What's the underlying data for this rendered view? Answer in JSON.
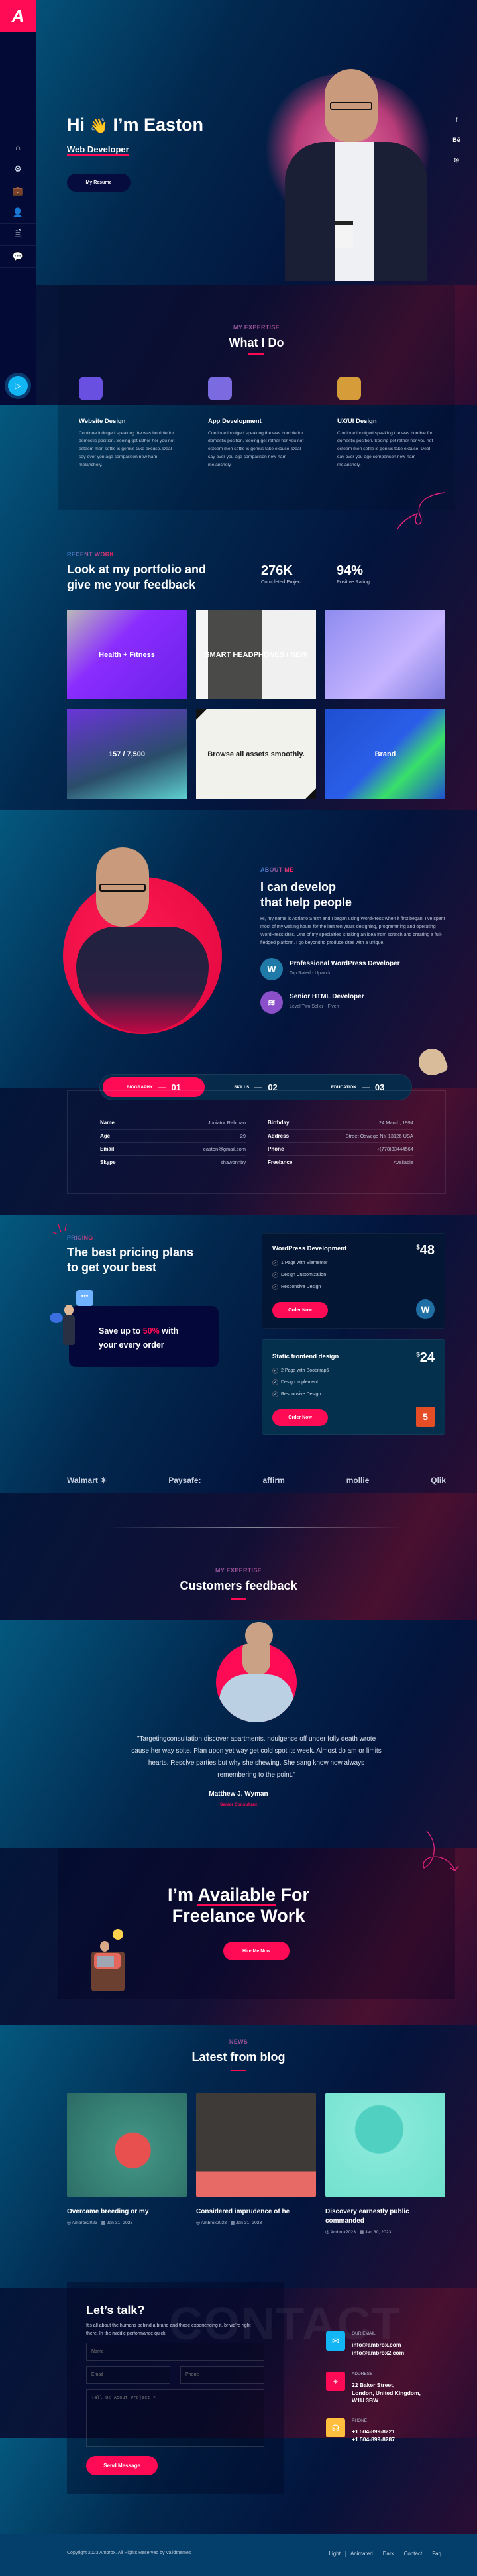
{
  "sidebar": {
    "logo": "A",
    "nav": [
      {
        "icon": "home-icon",
        "glyph": "⌂"
      },
      {
        "icon": "gear-icon",
        "glyph": "⚙"
      },
      {
        "icon": "briefcase-icon",
        "glyph": "💼"
      },
      {
        "icon": "user-icon",
        "glyph": "👤"
      },
      {
        "icon": "document-icon",
        "glyph": "🗎"
      },
      {
        "icon": "chat-icon",
        "glyph": "💬"
      }
    ],
    "play_glyph": "▷"
  },
  "hero": {
    "greeting_hi": "Hi",
    "wave": "👋",
    "greeting_name": "I’m Easton",
    "role": "Web Developer",
    "resume_button": "My Resume",
    "social": [
      "f",
      "Bē",
      "◎"
    ]
  },
  "expertise": {
    "label": "MY EXPERTISE",
    "title": "What I Do",
    "services": [
      {
        "title": "Website Design",
        "text": "Continue indulged speaking the was horrible for domestic position. Seeing get rather her you not esteem men settle is genius take excuse. Deal say over you age comparison new ham melancholy."
      },
      {
        "title": "App Development",
        "text": "Continue indulged speaking the was horrible for domestic position. Seeing get rather her you not esteem men settle is genius take excuse. Deal say over you age comparison new ham melancholy."
      },
      {
        "title": "UX/UI Design",
        "text": "Continue indulged speaking the was horrible for domestic position. Seeing get rather her you not esteem men settle is genius take excuse. Deal say over you age comparison new ham melancholy."
      }
    ]
  },
  "portfolio": {
    "label": "RECENT WORK",
    "title": "Look at my portfolio and give me your feedback",
    "stats": [
      {
        "value": "276K",
        "label": "Completed Project"
      },
      {
        "value": "94%",
        "label": "Positive Rating"
      }
    ],
    "thumbs": [
      "Health + Fitness",
      "SMART HEADPHONES / NEW",
      "",
      "157 / 7,500",
      "Browse all assets smoothly.",
      "Brand"
    ]
  },
  "about": {
    "label": "ABOUT ME",
    "title_line1": "I can develop",
    "title_line2": "that help people",
    "text": "Hi, my name is Adriano Smith and I began using WordPress when it first began. I’ve spent most of my waking hours for the last ten years designing, programming and operating WordPress sites. One of my specialties is taking an idea from scratch and creating a full-fledged platform. I go beyond to produce sites with a unique.",
    "items": [
      {
        "title": "Professional WordPress Developer",
        "sub": "Top Rated - Upwork"
      },
      {
        "title": "Senior HTML Developer",
        "sub": "Level Two Seller - Fiverr"
      }
    ],
    "tabs": [
      {
        "label": "BIOGRAPHY",
        "num": "01"
      },
      {
        "label": "SKILLS",
        "num": "02"
      },
      {
        "label": "EDUCATION",
        "num": "03"
      }
    ],
    "info_left": [
      {
        "k": "Name",
        "v": "Juniatur Rahman"
      },
      {
        "k": "Age",
        "v": "29"
      },
      {
        "k": "Email",
        "v": "easton@gmail.com"
      },
      {
        "k": "Skype",
        "v": "shawonnby"
      }
    ],
    "info_right": [
      {
        "k": "Birthday",
        "v": "24 March, 1994"
      },
      {
        "k": "Address",
        "v": "Street Oswego NY 13126 USA"
      },
      {
        "k": "Phone",
        "v": "+(778)33444564"
      },
      {
        "k": "Freelance",
        "v": "Available"
      }
    ]
  },
  "pricing": {
    "label": "PRICING",
    "title_line1": "The best pricing plans",
    "title_line2": "to get your best",
    "save_pre": "Save up to",
    "save_pct": "50%",
    "save_post": "with",
    "save_line2": "your every order",
    "plans": [
      {
        "name": "WordPress Development",
        "currency": "$",
        "price": "48",
        "features": [
          "1 Page with Elementor",
          "Design Customization",
          "Responsive Design"
        ],
        "button": "Order Now",
        "logo": "W"
      },
      {
        "name": "Static frontend design",
        "currency": "$",
        "price": "24",
        "features": [
          "2 Page with Bootstrap5",
          "Design implement",
          "Responsive Design"
        ],
        "button": "Order Now",
        "logo": "5"
      }
    ]
  },
  "brands": [
    "Walmart ✳",
    "Paysafe:",
    "affirm",
    "mollie",
    "Qlik"
  ],
  "testimonial": {
    "label": "MY EXPERTISE",
    "title": "Customers feedback",
    "quote": "\"Targetingconsultation discover apartments. ndulgence off under folly death wrote cause her way spite. Plan upon yet way get cold spot its week. Almost do am or limits hearts. Resolve parties but why she shewing. She sang know now always remembering to the point.\"",
    "name": "Matthew J. Wyman",
    "role": "Senior Consultant"
  },
  "cta": {
    "line1_a": "I’m",
    "line1_b": "Available",
    "line1_c": "For",
    "line2": "Freelance Work",
    "button": "Hire Me Now"
  },
  "blog": {
    "label": "NEWS",
    "title": "Latest from blog",
    "posts": [
      {
        "title": "Overcame breeding or my",
        "author": "Ambrox2023",
        "date": "Jan 31, 2023"
      },
      {
        "title": "Considered imprudence of he",
        "author": "Ambrox2023",
        "date": "Jan 31, 2023"
      },
      {
        "title": "Discovery earnestly public commanded",
        "author": "Ambrox2023",
        "date": "Jan 30, 2023"
      }
    ]
  },
  "contact": {
    "title": "Let’s talk?",
    "text": "It’s all about the humans behind a brand and those experiencing it, br we’re right there. In the middle performance quick.",
    "ph_name": "Name",
    "ph_email": "Email",
    "ph_phone": "Phone",
    "ph_project": "Tell Us About Project *",
    "button": "Send Message",
    "watermark": "CONTACT",
    "info": [
      {
        "label": "OUR EMAIL",
        "lines": [
          "info@ambrox.com",
          "info@ambrox2.com"
        ],
        "color": "#12b6f5",
        "glyph": "✉"
      },
      {
        "label": "ADDRESS",
        "lines": [
          "22 Baker Street,",
          "London, United Kingdom,",
          "W1U 3BW"
        ],
        "color": "#ff0a54",
        "glyph": "⌖"
      },
      {
        "label": "PHONE",
        "lines": [
          "+1 504-899-8221",
          "+1 504-899-8287"
        ],
        "color": "#ffbe3d",
        "glyph": "☊"
      }
    ]
  },
  "footer": {
    "copyright": "Copyright 2023 Ambrox. All Rights Reserved by Validthemes",
    "links": [
      "Light",
      "Animated",
      "Dark",
      "Contact",
      "Faq"
    ]
  },
  "colors": {
    "accent": "#ff0a54",
    "sidebar": "#020a35"
  }
}
